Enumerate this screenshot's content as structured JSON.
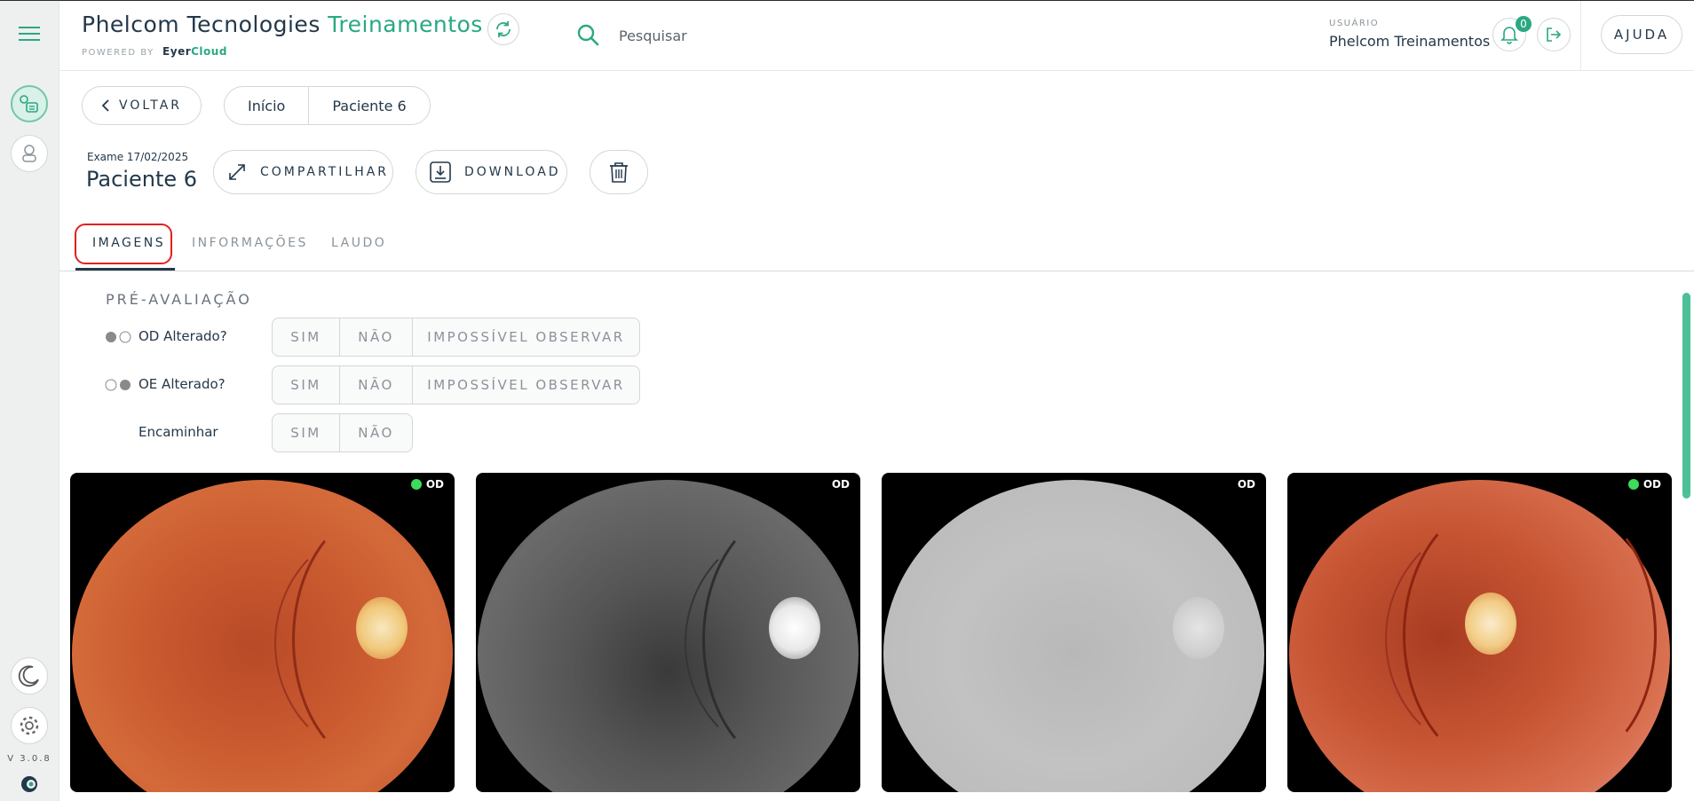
{
  "header": {
    "brand_main": "Phelcom Tecnologies",
    "brand_accent": "Treinamentos",
    "powered_by": "POWERED BY",
    "powered_brand_a": "Eyer",
    "powered_brand_b": "Cloud",
    "search_placeholder": "Pesquisar",
    "user_label": "USUÁRIO",
    "user_name": "Phelcom Treinamentos",
    "notifications": "0",
    "help": "AJUDA"
  },
  "sidebar": {
    "version": "V 3.0.8",
    "icons": [
      "menu-icon",
      "exams-icon",
      "user-icon",
      "moon-icon",
      "gear-icon",
      "logo-icon"
    ]
  },
  "nav": {
    "back": "VOLTAR",
    "breadcrumb": [
      "Início",
      "Paciente 6"
    ]
  },
  "exam": {
    "date": "Exame 17/02/2025",
    "patient": "Paciente 6",
    "share": "COMPARTILHAR",
    "download": "DOWNLOAD"
  },
  "tabs": [
    "IMAGENS",
    "INFORMAÇÕES",
    "LAUDO"
  ],
  "pre_evaluation": {
    "title": "PRÉ-AVALIAÇÃO",
    "rows": [
      {
        "label": "OD Alterado?",
        "options": [
          "SIM",
          "NÃO",
          "IMPOSSÍVEL OBSERVAR"
        ]
      },
      {
        "label": "OE Alterado?",
        "options": [
          "SIM",
          "NÃO",
          "IMPOSSÍVEL OBSERVAR"
        ]
      },
      {
        "label": "Encaminhar",
        "options": [
          "SIM",
          "NÃO"
        ]
      }
    ]
  },
  "images": [
    {
      "eye": "OD",
      "type": "color",
      "selected": true
    },
    {
      "eye": "OD",
      "type": "red-free",
      "selected": false
    },
    {
      "eye": "OD",
      "type": "grayscale",
      "selected": false
    },
    {
      "eye": "OD",
      "type": "color",
      "selected": true
    }
  ],
  "colors": {
    "accent": "#2aa882",
    "text": "#23384a",
    "highlight": "#e02020"
  }
}
